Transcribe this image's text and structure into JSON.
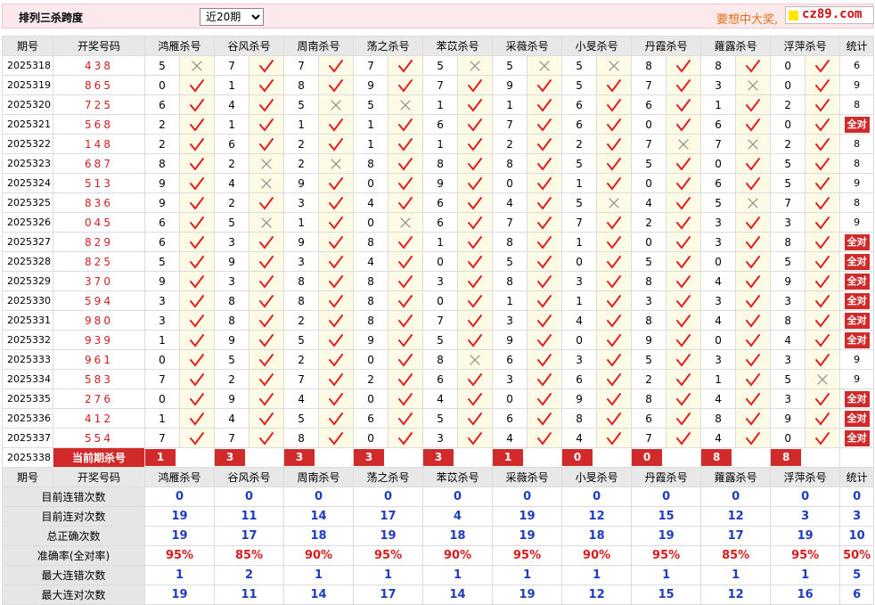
{
  "header": {
    "title": "排列三杀跨度",
    "period_select": {
      "selected": "近20期"
    },
    "promo": "要想中大奖,",
    "logo": "cz89.com"
  },
  "table": {
    "columns": [
      "期号",
      "开奖号码",
      "鸿雁杀号",
      "谷风杀号",
      "周南杀号",
      "荡之杀号",
      "苯苡杀号",
      "采薇杀号",
      "小旻杀号",
      "丹霞杀号",
      "蕹露杀号",
      "浮萍杀号",
      "统计"
    ],
    "all_right_label": "全对",
    "current_label": "当前期杀号",
    "rows": [
      {
        "period": "2025318",
        "draw": "438",
        "kills": [
          [
            5,
            0
          ],
          [
            7,
            1
          ],
          [
            7,
            1
          ],
          [
            7,
            1
          ],
          [
            5,
            0
          ],
          [
            5,
            0
          ],
          [
            5,
            0
          ],
          [
            8,
            1
          ],
          [
            8,
            1
          ],
          [
            0,
            1
          ]
        ],
        "stat": "6"
      },
      {
        "period": "2025319",
        "draw": "865",
        "kills": [
          [
            0,
            1
          ],
          [
            1,
            1
          ],
          [
            8,
            1
          ],
          [
            9,
            1
          ],
          [
            7,
            1
          ],
          [
            9,
            1
          ],
          [
            5,
            1
          ],
          [
            7,
            1
          ],
          [
            3,
            0
          ],
          [
            0,
            1
          ]
        ],
        "stat": "9"
      },
      {
        "period": "2025320",
        "draw": "725",
        "kills": [
          [
            6,
            1
          ],
          [
            4,
            1
          ],
          [
            5,
            0
          ],
          [
            5,
            0
          ],
          [
            1,
            1
          ],
          [
            1,
            1
          ],
          [
            6,
            1
          ],
          [
            6,
            1
          ],
          [
            1,
            1
          ],
          [
            2,
            1
          ]
        ],
        "stat": "8"
      },
      {
        "period": "2025321",
        "draw": "568",
        "kills": [
          [
            2,
            1
          ],
          [
            1,
            1
          ],
          [
            1,
            1
          ],
          [
            1,
            1
          ],
          [
            6,
            1
          ],
          [
            7,
            1
          ],
          [
            6,
            1
          ],
          [
            0,
            1
          ],
          [
            6,
            1
          ],
          [
            0,
            1
          ]
        ],
        "stat": "全对"
      },
      {
        "period": "2025322",
        "draw": "148",
        "kills": [
          [
            2,
            1
          ],
          [
            6,
            1
          ],
          [
            2,
            1
          ],
          [
            1,
            1
          ],
          [
            1,
            1
          ],
          [
            2,
            1
          ],
          [
            2,
            1
          ],
          [
            7,
            0
          ],
          [
            7,
            0
          ],
          [
            2,
            1
          ]
        ],
        "stat": "8"
      },
      {
        "period": "2025323",
        "draw": "687",
        "kills": [
          [
            8,
            1
          ],
          [
            2,
            0
          ],
          [
            2,
            0
          ],
          [
            8,
            1
          ],
          [
            8,
            1
          ],
          [
            8,
            1
          ],
          [
            5,
            1
          ],
          [
            5,
            1
          ],
          [
            0,
            1
          ],
          [
            5,
            1
          ]
        ],
        "stat": "8"
      },
      {
        "period": "2025324",
        "draw": "513",
        "kills": [
          [
            9,
            1
          ],
          [
            4,
            0
          ],
          [
            9,
            1
          ],
          [
            0,
            1
          ],
          [
            9,
            1
          ],
          [
            0,
            1
          ],
          [
            1,
            1
          ],
          [
            0,
            1
          ],
          [
            6,
            1
          ],
          [
            5,
            1
          ]
        ],
        "stat": "9"
      },
      {
        "period": "2025325",
        "draw": "836",
        "kills": [
          [
            9,
            1
          ],
          [
            2,
            1
          ],
          [
            3,
            1
          ],
          [
            4,
            1
          ],
          [
            6,
            1
          ],
          [
            4,
            1
          ],
          [
            5,
            0
          ],
          [
            4,
            1
          ],
          [
            5,
            0
          ],
          [
            7,
            1
          ]
        ],
        "stat": "8"
      },
      {
        "period": "2025326",
        "draw": "045",
        "kills": [
          [
            6,
            1
          ],
          [
            5,
            0
          ],
          [
            1,
            1
          ],
          [
            0,
            0
          ],
          [
            6,
            1
          ],
          [
            7,
            1
          ],
          [
            7,
            1
          ],
          [
            2,
            1
          ],
          [
            3,
            1
          ],
          [
            3,
            1
          ]
        ],
        "stat": "9"
      },
      {
        "period": "2025327",
        "draw": "829",
        "kills": [
          [
            6,
            1
          ],
          [
            3,
            1
          ],
          [
            9,
            1
          ],
          [
            8,
            1
          ],
          [
            1,
            1
          ],
          [
            8,
            1
          ],
          [
            1,
            1
          ],
          [
            0,
            1
          ],
          [
            3,
            1
          ],
          [
            8,
            1
          ]
        ],
        "stat": "全对"
      },
      {
        "period": "2025328",
        "draw": "825",
        "kills": [
          [
            5,
            1
          ],
          [
            9,
            1
          ],
          [
            3,
            1
          ],
          [
            4,
            1
          ],
          [
            0,
            1
          ],
          [
            5,
            1
          ],
          [
            0,
            1
          ],
          [
            5,
            1
          ],
          [
            0,
            1
          ],
          [
            5,
            1
          ]
        ],
        "stat": "全对"
      },
      {
        "period": "2025329",
        "draw": "370",
        "kills": [
          [
            9,
            1
          ],
          [
            3,
            1
          ],
          [
            8,
            1
          ],
          [
            8,
            1
          ],
          [
            3,
            1
          ],
          [
            8,
            1
          ],
          [
            3,
            1
          ],
          [
            8,
            1
          ],
          [
            4,
            1
          ],
          [
            9,
            1
          ]
        ],
        "stat": "全对"
      },
      {
        "period": "2025330",
        "draw": "594",
        "kills": [
          [
            3,
            1
          ],
          [
            8,
            1
          ],
          [
            8,
            1
          ],
          [
            8,
            1
          ],
          [
            0,
            1
          ],
          [
            1,
            1
          ],
          [
            1,
            1
          ],
          [
            3,
            1
          ],
          [
            3,
            1
          ],
          [
            3,
            1
          ]
        ],
        "stat": "全对"
      },
      {
        "period": "2025331",
        "draw": "980",
        "kills": [
          [
            3,
            1
          ],
          [
            8,
            1
          ],
          [
            2,
            1
          ],
          [
            8,
            1
          ],
          [
            7,
            1
          ],
          [
            3,
            1
          ],
          [
            4,
            1
          ],
          [
            8,
            1
          ],
          [
            4,
            1
          ],
          [
            8,
            1
          ]
        ],
        "stat": "全对"
      },
      {
        "period": "2025332",
        "draw": "939",
        "kills": [
          [
            1,
            1
          ],
          [
            9,
            1
          ],
          [
            5,
            1
          ],
          [
            9,
            1
          ],
          [
            5,
            1
          ],
          [
            9,
            1
          ],
          [
            0,
            1
          ],
          [
            9,
            1
          ],
          [
            0,
            1
          ],
          [
            4,
            1
          ]
        ],
        "stat": "全对"
      },
      {
        "period": "2025333",
        "draw": "961",
        "kills": [
          [
            0,
            1
          ],
          [
            5,
            1
          ],
          [
            2,
            1
          ],
          [
            0,
            1
          ],
          [
            8,
            0
          ],
          [
            6,
            1
          ],
          [
            3,
            1
          ],
          [
            5,
            1
          ],
          [
            3,
            1
          ],
          [
            3,
            1
          ]
        ],
        "stat": "9"
      },
      {
        "period": "2025334",
        "draw": "583",
        "kills": [
          [
            7,
            1
          ],
          [
            2,
            1
          ],
          [
            7,
            1
          ],
          [
            2,
            1
          ],
          [
            6,
            1
          ],
          [
            3,
            1
          ],
          [
            6,
            1
          ],
          [
            2,
            1
          ],
          [
            1,
            1
          ],
          [
            5,
            0
          ]
        ],
        "stat": "9"
      },
      {
        "period": "2025335",
        "draw": "276",
        "kills": [
          [
            0,
            1
          ],
          [
            9,
            1
          ],
          [
            4,
            1
          ],
          [
            0,
            1
          ],
          [
            4,
            1
          ],
          [
            0,
            1
          ],
          [
            9,
            1
          ],
          [
            8,
            1
          ],
          [
            4,
            1
          ],
          [
            3,
            1
          ]
        ],
        "stat": "全对"
      },
      {
        "period": "2025336",
        "draw": "412",
        "kills": [
          [
            1,
            1
          ],
          [
            4,
            1
          ],
          [
            5,
            1
          ],
          [
            6,
            1
          ],
          [
            5,
            1
          ],
          [
            6,
            1
          ],
          [
            8,
            1
          ],
          [
            6,
            1
          ],
          [
            8,
            1
          ],
          [
            9,
            1
          ]
        ],
        "stat": "全对"
      },
      {
        "period": "2025337",
        "draw": "554",
        "kills": [
          [
            7,
            1
          ],
          [
            7,
            1
          ],
          [
            8,
            1
          ],
          [
            0,
            1
          ],
          [
            3,
            1
          ],
          [
            4,
            1
          ],
          [
            4,
            1
          ],
          [
            7,
            1
          ],
          [
            4,
            1
          ],
          [
            0,
            1
          ]
        ],
        "stat": "全对"
      }
    ],
    "current": {
      "period": "2025338",
      "kills": [
        "1",
        "3",
        "3",
        "3",
        "3",
        "1",
        "0",
        "0",
        "8",
        "8"
      ]
    },
    "summary": [
      {
        "label": "目前连错次数",
        "values": [
          "0",
          "0",
          "0",
          "0",
          "0",
          "0",
          "0",
          "0",
          "0",
          "0",
          "0"
        ],
        "red": false
      },
      {
        "label": "目前连对次数",
        "values": [
          "19",
          "11",
          "14",
          "17",
          "4",
          "19",
          "12",
          "15",
          "12",
          "3",
          "3"
        ],
        "red": false
      },
      {
        "label": "总正确次数",
        "values": [
          "19",
          "17",
          "18",
          "19",
          "18",
          "19",
          "18",
          "19",
          "17",
          "19",
          "10"
        ],
        "red": false
      },
      {
        "label": "准确率(全对率)",
        "values": [
          "95%",
          "85%",
          "90%",
          "95%",
          "90%",
          "95%",
          "90%",
          "95%",
          "85%",
          "95%",
          "50%"
        ],
        "red": true
      },
      {
        "label": "最大连错次数",
        "values": [
          "1",
          "2",
          "1",
          "1",
          "1",
          "1",
          "1",
          "1",
          "1",
          "1",
          "5"
        ],
        "red": false
      },
      {
        "label": "最大连对次数",
        "values": [
          "19",
          "11",
          "14",
          "17",
          "14",
          "19",
          "12",
          "15",
          "12",
          "16",
          "6"
        ],
        "red": false
      }
    ]
  }
}
